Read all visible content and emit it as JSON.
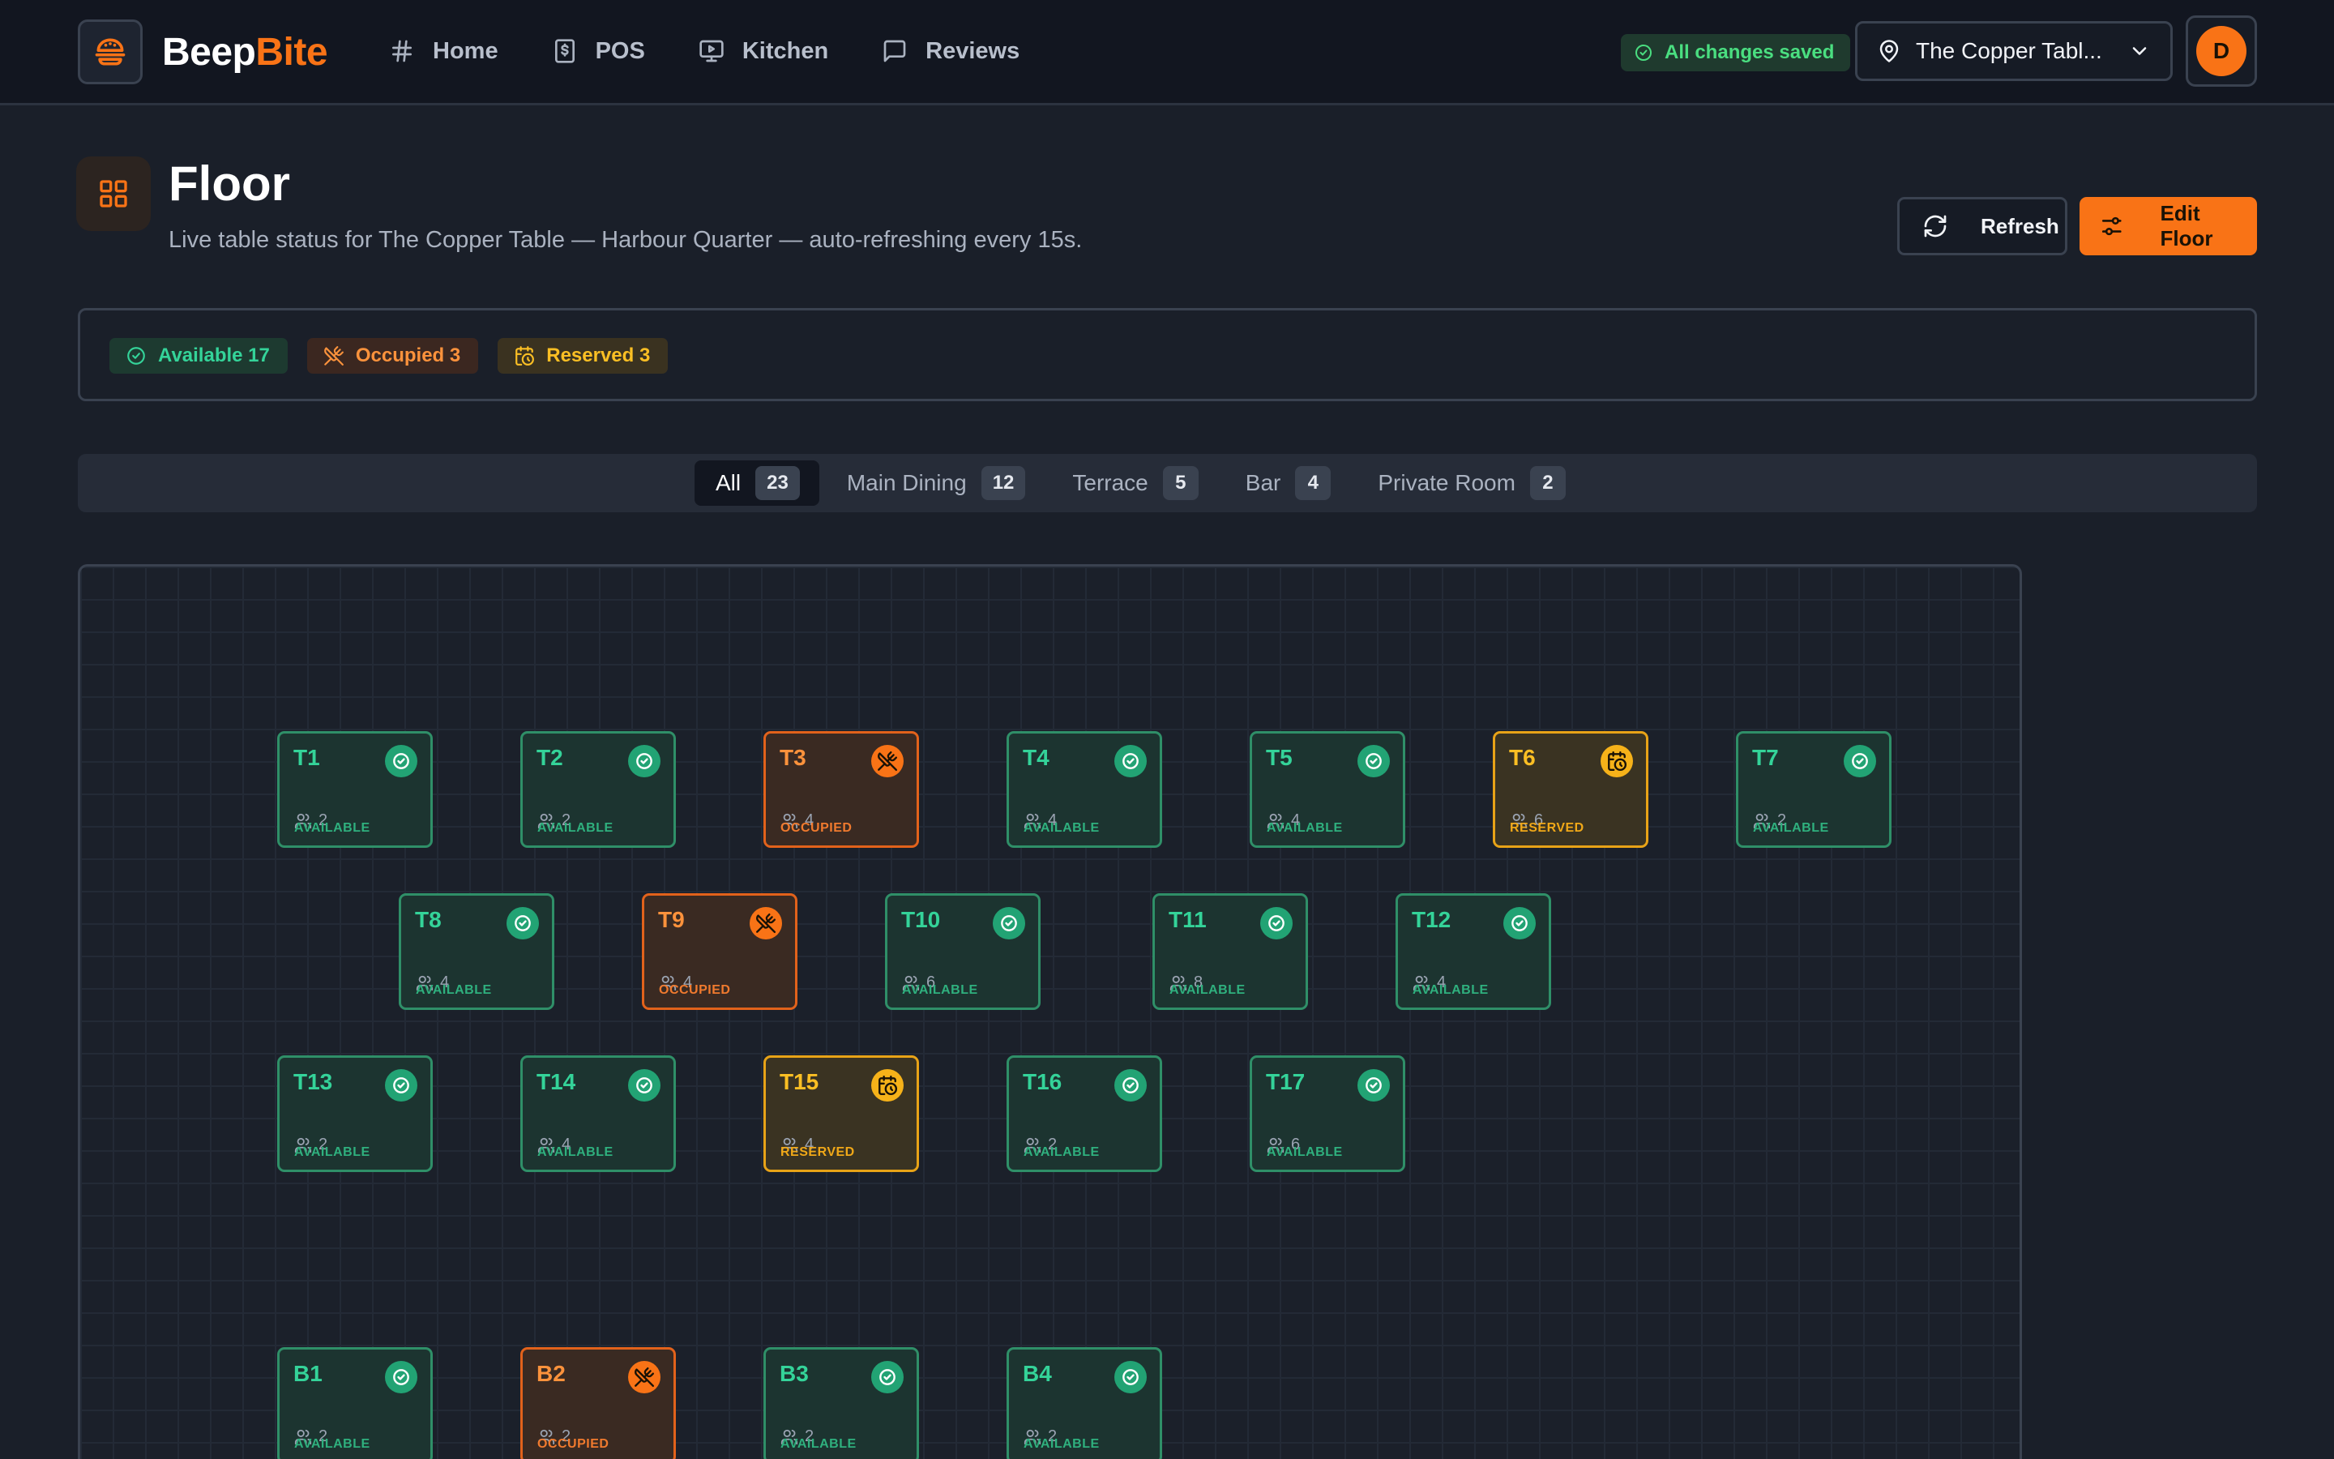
{
  "app": {
    "brand_part1": "Beep",
    "brand_part2": "Bite",
    "colors": {
      "accent": "#f97316",
      "available": "#34d399",
      "occupied": "#fb923c",
      "reserved": "#fbbf24"
    }
  },
  "nav": [
    {
      "label": "Home",
      "icon": "hash-icon"
    },
    {
      "label": "POS",
      "icon": "dollar-receipt-icon"
    },
    {
      "label": "Kitchen",
      "icon": "monitor-play-icon"
    },
    {
      "label": "Reviews",
      "icon": "message-square-icon"
    }
  ],
  "topbar": {
    "save_status": "All changes saved",
    "location": "The Copper Tabl...",
    "avatar_initial": "D"
  },
  "header": {
    "title": "Floor",
    "subtitle": "Live table status for The Copper Table — Harbour Quarter — auto-refreshing every 15s.",
    "refresh_label": "Refresh",
    "edit_label": "Edit Floor"
  },
  "legend": {
    "available": "Available 17",
    "occupied": "Occupied 3",
    "reserved": "Reserved 3"
  },
  "tabs": [
    {
      "label": "All",
      "count": "23",
      "active": true
    },
    {
      "label": "Main Dining",
      "count": "12"
    },
    {
      "label": "Terrace",
      "count": "5"
    },
    {
      "label": "Bar",
      "count": "4"
    },
    {
      "label": "Private Room",
      "count": "2"
    }
  ],
  "status_labels": {
    "available": "AVAILABLE",
    "occupied": "OCCUPIED",
    "reserved": "RESERVED"
  },
  "tables": [
    {
      "name": "T1",
      "status": "available",
      "seats": "2"
    },
    {
      "name": "T2",
      "status": "available",
      "seats": "2"
    },
    {
      "name": "T3",
      "status": "occupied",
      "seats": "4"
    },
    {
      "name": "T4",
      "status": "available",
      "seats": "4"
    },
    {
      "name": "T5",
      "status": "available",
      "seats": "4"
    },
    {
      "name": "T6",
      "status": "reserved",
      "seats": "6"
    },
    {
      "name": "T7",
      "status": "available",
      "seats": "2"
    },
    {
      "name": "T8",
      "status": "available",
      "seats": "4"
    },
    {
      "name": "T9",
      "status": "occupied",
      "seats": "4"
    },
    {
      "name": "T10",
      "status": "available",
      "seats": "6"
    },
    {
      "name": "T11",
      "status": "available",
      "seats": "8"
    },
    {
      "name": "T12",
      "status": "available",
      "seats": "4"
    },
    {
      "name": "T13",
      "status": "available",
      "seats": "2"
    },
    {
      "name": "T14",
      "status": "available",
      "seats": "4"
    },
    {
      "name": "T15",
      "status": "reserved",
      "seats": "4"
    },
    {
      "name": "T16",
      "status": "available",
      "seats": "2"
    },
    {
      "name": "T17",
      "status": "available",
      "seats": "6"
    },
    {
      "name": "B1",
      "status": "available",
      "seats": "2"
    },
    {
      "name": "B2",
      "status": "occupied",
      "seats": "2"
    },
    {
      "name": "B3",
      "status": "available",
      "seats": "2"
    },
    {
      "name": "B4",
      "status": "available",
      "seats": "2"
    }
  ]
}
